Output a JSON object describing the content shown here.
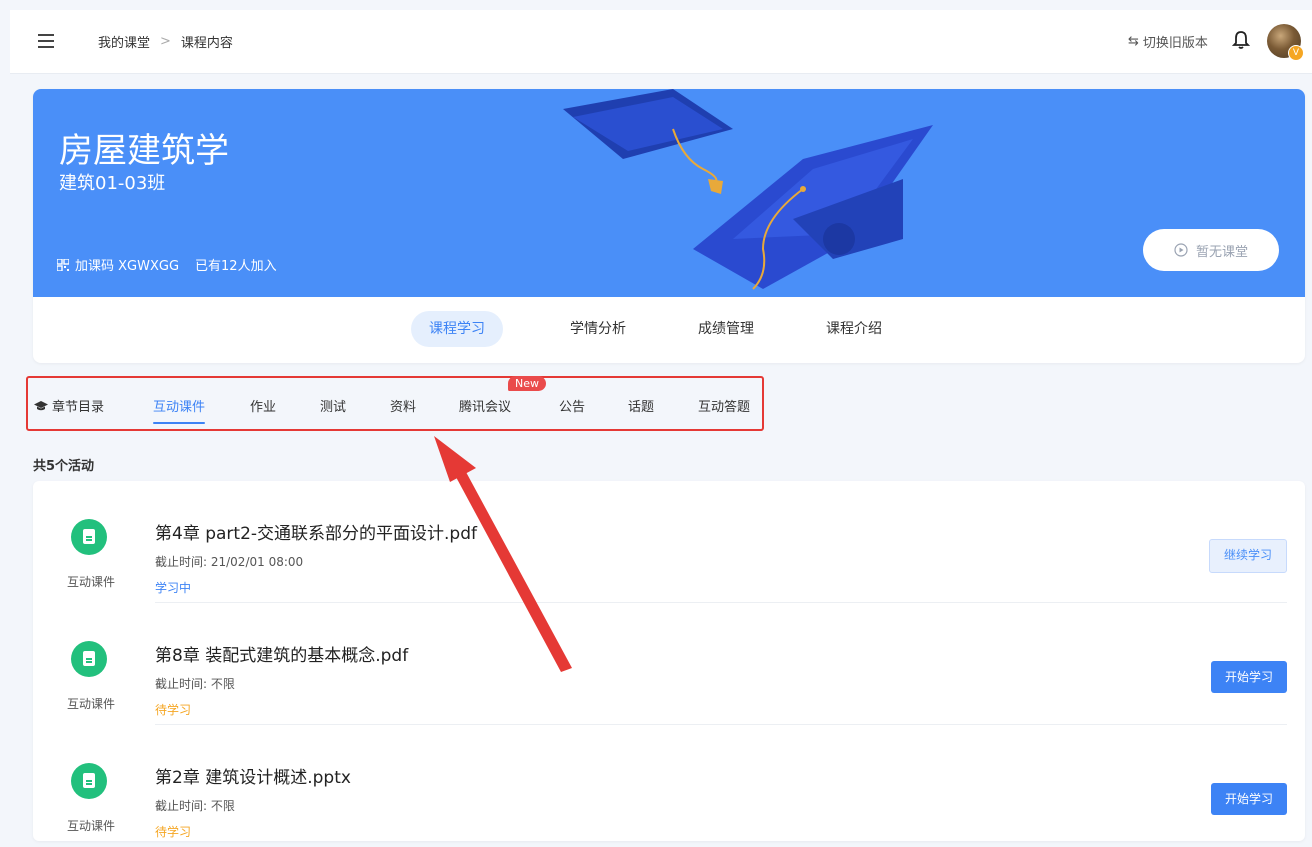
{
  "header": {
    "breadcrumb": [
      "我的课堂",
      "课程内容"
    ],
    "switch_version": "切换旧版本",
    "avatar_badge": "V"
  },
  "banner": {
    "course_title": "房屋建筑学",
    "class_name": "建筑01-03班",
    "join_code": "加课码 XGWXGG",
    "joined_count": "已有12人加入",
    "no_class_label": "暂无课堂",
    "bg_color": "#4a8ff8"
  },
  "main_tabs": [
    {
      "label": "课程学习",
      "active": true
    },
    {
      "label": "学情分析",
      "active": false
    },
    {
      "label": "成绩管理",
      "active": false
    },
    {
      "label": "课程介绍",
      "active": false
    }
  ],
  "sub_tabs": [
    {
      "label": "章节目录",
      "icon": "graduation-cap-icon"
    },
    {
      "label": "互动课件",
      "active": true
    },
    {
      "label": "作业"
    },
    {
      "label": "测试"
    },
    {
      "label": "资料"
    },
    {
      "label": "腾讯会议",
      "badge": "New"
    },
    {
      "label": "公告"
    },
    {
      "label": "话题"
    },
    {
      "label": "互动答题"
    }
  ],
  "activity_count": "共5个活动",
  "activities": [
    {
      "type": "互动课件",
      "name": "第4章 part2-交通联系部分的平面设计.pdf",
      "deadline": "截止时间: 21/02/01 08:00",
      "status": "学习中",
      "status_color": "#3d83f5",
      "button": "继续学习",
      "button_style": "ghost"
    },
    {
      "type": "互动课件",
      "name": "第8章 装配式建筑的基本概念.pdf",
      "deadline": "截止时间: 不限",
      "status": "待学习",
      "status_color": "#f5a623",
      "button": "开始学习",
      "button_style": "primary"
    },
    {
      "type": "互动课件",
      "name": "第2章 建筑设计概述.pptx",
      "deadline": "截止时间: 不限",
      "status": "待学习",
      "status_color": "#f5a623",
      "button": "开始学习",
      "button_style": "primary"
    }
  ],
  "colors": {
    "accent": "#3d83f5",
    "annotation_red": "#e53935",
    "icon_green": "#22c07d"
  }
}
